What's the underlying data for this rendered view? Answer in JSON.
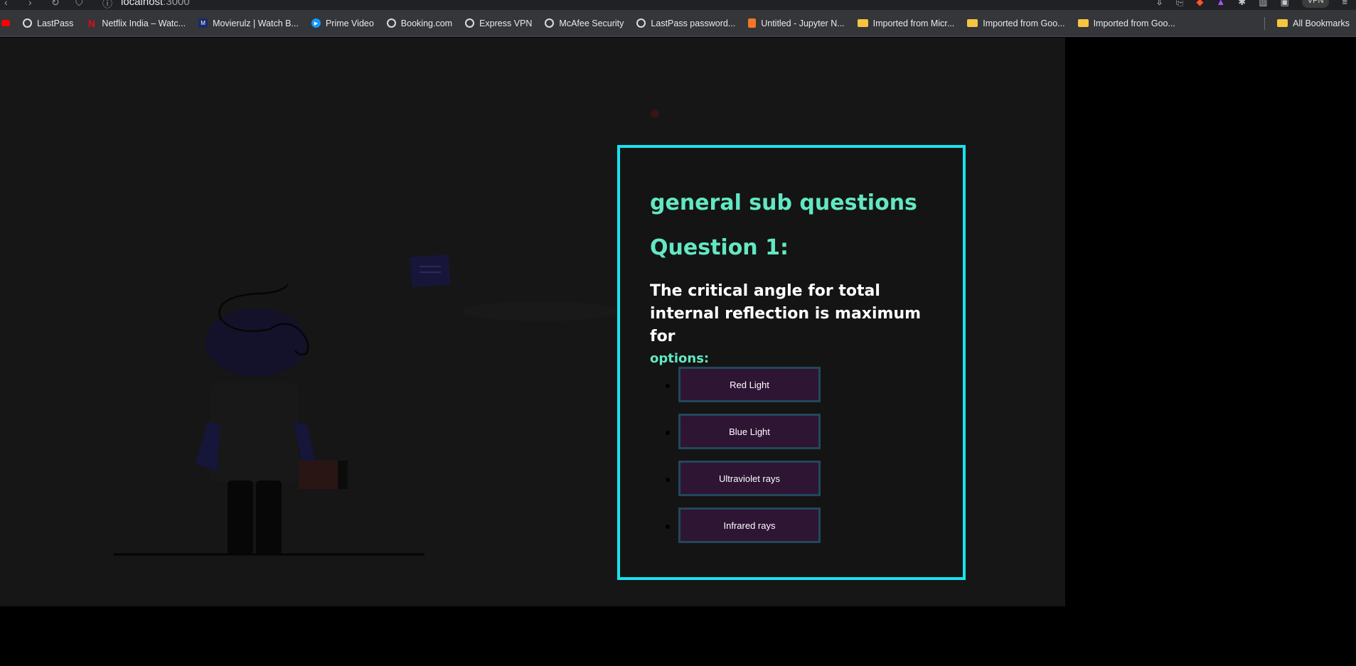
{
  "browser": {
    "url_host": "localhost",
    "url_port": ":3000",
    "vpn_label": "VPN",
    "bookmarks": [
      {
        "label": "LastPass",
        "icon": "globe-icon"
      },
      {
        "label": "Netflix India – Watc...",
        "icon": "netflix-icon"
      },
      {
        "label": "Movierulz | Watch B...",
        "icon": "movierulz-icon"
      },
      {
        "label": "Prime Video",
        "icon": "prime-video-icon"
      },
      {
        "label": "Booking.com",
        "icon": "globe-icon"
      },
      {
        "label": "Express VPN",
        "icon": "globe-icon"
      },
      {
        "label": "McAfee Security",
        "icon": "globe-icon"
      },
      {
        "label": "LastPass password...",
        "icon": "globe-icon"
      },
      {
        "label": "Untitled - Jupyter N...",
        "icon": "jupyter-icon"
      },
      {
        "label": "Imported from Micr...",
        "icon": "folder-icon"
      },
      {
        "label": "Imported from Goo...",
        "icon": "folder-icon"
      },
      {
        "label": "Imported from Goo...",
        "icon": "folder-icon"
      }
    ],
    "all_bookmarks_label": "All Bookmarks"
  },
  "quiz": {
    "title": "general sub questions",
    "question_number": "Question 1:",
    "question_text": "The critical angle for total internal reflection is maximum for",
    "options_label": "options:",
    "options": [
      "Red Light",
      "Blue Light",
      "Ultraviolet rays",
      "Infrared rays"
    ]
  },
  "colors": {
    "accent_text": "#62e8c2",
    "card_border": "#19e3f0",
    "option_bg": "#2e1534",
    "option_border": "#22485a",
    "page_bg": "#161616"
  }
}
